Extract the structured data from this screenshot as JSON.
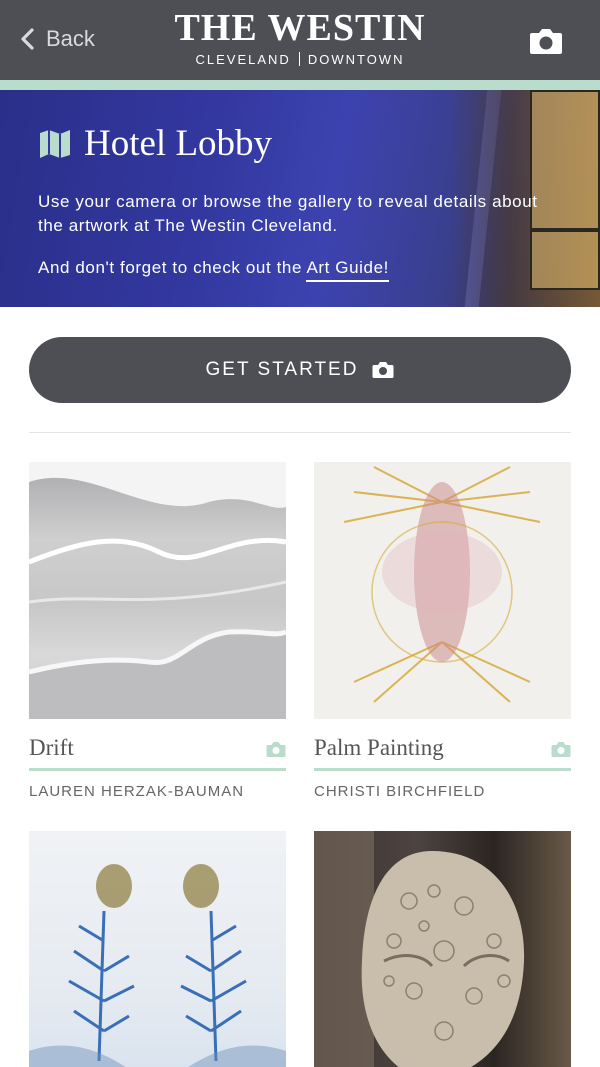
{
  "header": {
    "back_label": "Back",
    "brand_title": "THE WESTIN",
    "brand_city": "CLEVELAND",
    "brand_area": "DOWNTOWN",
    "camera_icon": "camera-icon"
  },
  "hero": {
    "title": "Hotel Lobby",
    "title_icon": "map-icon",
    "description": "Use your camera or browse the gallery to reveal details about the artwork at The Westin Cleveland.",
    "reminder_prefix": "And don't forget to check out the ",
    "art_guide_link": "Art Guide!"
  },
  "get_started": {
    "label": "GET STARTED",
    "icon": "camera-icon"
  },
  "colors": {
    "bar": "#4d4f54",
    "accent": "#b9dccd",
    "text": "#555555"
  },
  "artworks": [
    {
      "title": "Drift",
      "artist": "LAUREN HERZAK-BAUMAN",
      "icon": "camera-icon"
    },
    {
      "title": "Palm Painting",
      "artist": "CHRISTI BIRCHFIELD",
      "icon": "camera-icon"
    },
    {
      "title": "",
      "artist": ""
    },
    {
      "title": "",
      "artist": ""
    }
  ]
}
